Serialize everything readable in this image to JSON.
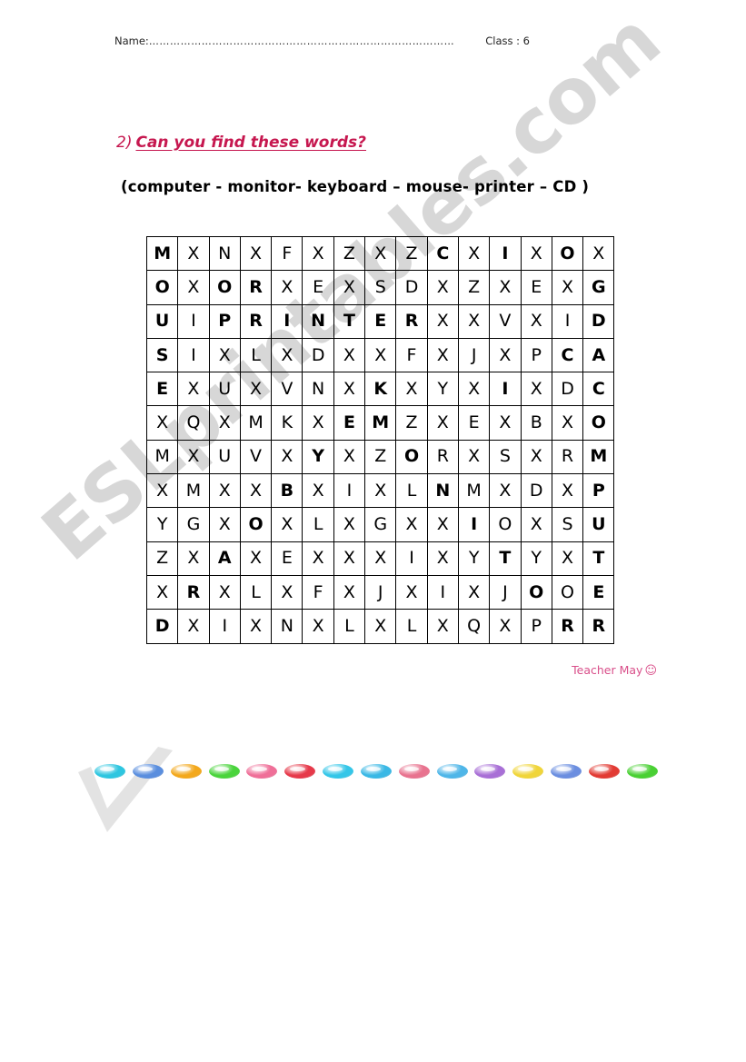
{
  "header": {
    "name_label": "Name:",
    "name_dots": "……………………………………………………………………………",
    "class_label": "Class : 6"
  },
  "question": {
    "number": "2)",
    "text": "Can you find these words?",
    "color": "#c6174f"
  },
  "word_list": {
    "text": "(computer -  monitor-  keyboard – mouse-  printer – CD )",
    "words": [
      "computer",
      "monitor",
      "keyboard",
      "mouse",
      "printer",
      "CD"
    ]
  },
  "signature": {
    "text": "Teacher May",
    "smiley": "☺",
    "color": "#d94f8a"
  },
  "watermark": {
    "text": "ESLprintables.com",
    "color": "#c9c9c9"
  },
  "grid": {
    "columns": 15,
    "rows": 12,
    "letters": [
      [
        "M",
        "X",
        "N",
        "X",
        "F",
        "X",
        "Z",
        "X",
        "Z",
        "C",
        "X",
        "I",
        "X",
        "O",
        "X"
      ],
      [
        "O",
        "X",
        "O",
        "R",
        "X",
        "E",
        "X",
        "S",
        "D",
        "X",
        "Z",
        "X",
        "E",
        "X",
        "G"
      ],
      [
        "U",
        "I",
        "P",
        "R",
        "I",
        "N",
        "T",
        "E",
        "R",
        "X",
        "X",
        "V",
        "X",
        "I",
        "D"
      ],
      [
        "S",
        "I",
        "X",
        "L",
        "X",
        "D",
        "X",
        "X",
        "F",
        "X",
        "J",
        "X",
        "P",
        "C",
        "A"
      ],
      [
        "E",
        "X",
        "U",
        "X",
        "V",
        "N",
        "X",
        "K",
        "X",
        "Y",
        "X",
        "I",
        "X",
        "D",
        "C"
      ],
      [
        "X",
        "Q",
        "X",
        "M",
        "K",
        "X",
        "E",
        "M",
        "Z",
        "X",
        "E",
        "X",
        "B",
        "X",
        "O"
      ],
      [
        "M",
        "X",
        "U",
        "V",
        "X",
        "Y",
        "X",
        "Z",
        "O",
        "R",
        "X",
        "S",
        "X",
        "R",
        "M"
      ],
      [
        "X",
        "M",
        "X",
        "X",
        "B",
        "X",
        "I",
        "X",
        "L",
        "N",
        "M",
        "X",
        "D",
        "X",
        "P"
      ],
      [
        "Y",
        "G",
        "X",
        "O",
        "X",
        "L",
        "X",
        "G",
        "X",
        "X",
        "I",
        "O",
        "X",
        "S",
        "U"
      ],
      [
        "Z",
        "X",
        "A",
        "X",
        "E",
        "X",
        "X",
        "X",
        "I",
        "X",
        "Y",
        "T",
        "Y",
        "X",
        "T"
      ],
      [
        "X",
        "R",
        "X",
        "L",
        "X",
        "F",
        "X",
        "J",
        "X",
        "I",
        "X",
        "J",
        "O",
        "O",
        "E"
      ],
      [
        "D",
        "X",
        "I",
        "X",
        "N",
        "X",
        "L",
        "X",
        "L",
        "X",
        "Q",
        "X",
        "P",
        "R",
        "R"
      ]
    ],
    "bold": [
      [
        1,
        0,
        0,
        0,
        0,
        0,
        0,
        0,
        0,
        1,
        0,
        1,
        0,
        1,
        0
      ],
      [
        1,
        0,
        1,
        1,
        0,
        0,
        0,
        0,
        0,
        0,
        0,
        0,
        0,
        0,
        1
      ],
      [
        1,
        0,
        1,
        1,
        1,
        1,
        1,
        1,
        1,
        0,
        0,
        0,
        0,
        0,
        1
      ],
      [
        1,
        0,
        0,
        0,
        0,
        0,
        0,
        0,
        0,
        0,
        0,
        0,
        0,
        1,
        1
      ],
      [
        1,
        0,
        0,
        0,
        0,
        0,
        0,
        1,
        0,
        0,
        0,
        1,
        0,
        0,
        1
      ],
      [
        0,
        0,
        0,
        0,
        0,
        0,
        1,
        1,
        0,
        0,
        0,
        0,
        0,
        0,
        1
      ],
      [
        0,
        0,
        0,
        0,
        0,
        1,
        0,
        0,
        1,
        0,
        0,
        0,
        0,
        0,
        1
      ],
      [
        0,
        0,
        0,
        0,
        1,
        0,
        0,
        0,
        0,
        1,
        0,
        0,
        0,
        0,
        1
      ],
      [
        0,
        0,
        0,
        1,
        0,
        0,
        0,
        0,
        0,
        0,
        1,
        0,
        0,
        0,
        1
      ],
      [
        0,
        0,
        1,
        0,
        0,
        0,
        0,
        0,
        0,
        0,
        0,
        1,
        0,
        0,
        1
      ],
      [
        0,
        1,
        0,
        0,
        0,
        0,
        0,
        0,
        0,
        0,
        0,
        0,
        1,
        0,
        1
      ],
      [
        1,
        0,
        0,
        0,
        0,
        0,
        0,
        0,
        0,
        0,
        0,
        0,
        0,
        1,
        1
      ]
    ]
  },
  "beads": {
    "colors": [
      "#2ec6e0",
      "#5a8ede",
      "#f3a81c",
      "#4ad43c",
      "#ef6f98",
      "#e6394a",
      "#34c6e8",
      "#3ab8e5",
      "#e8738f",
      "#4fb6e8",
      "#a86fd6",
      "#f0d53a",
      "#6b8ee0",
      "#e23b34",
      "#49d033"
    ]
  }
}
